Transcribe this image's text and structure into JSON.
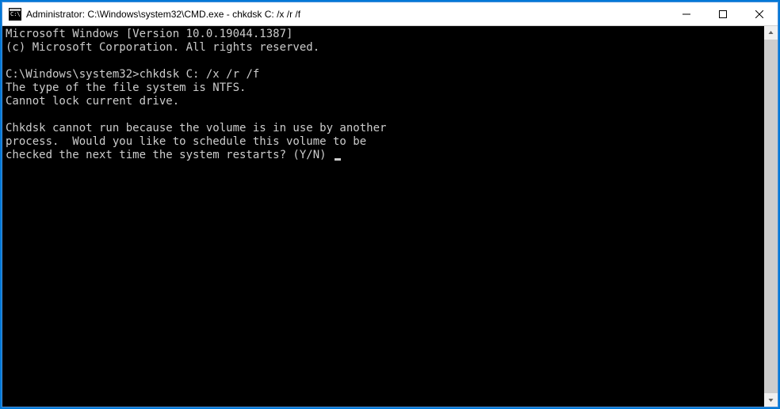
{
  "window": {
    "title": "Administrator: C:\\Windows\\system32\\CMD.exe - chkdsk  C: /x /r /f"
  },
  "terminal": {
    "line1": "Microsoft Windows [Version 10.0.19044.1387]",
    "line2": "(c) Microsoft Corporation. All rights reserved.",
    "line3": "",
    "prompt": "C:\\Windows\\system32>",
    "command": "chkdsk C: /x /r /f",
    "line5": "The type of the file system is NTFS.",
    "line6": "Cannot lock current drive.",
    "line7": "",
    "line8": "Chkdsk cannot run because the volume is in use by another",
    "line9": "process.  Would you like to schedule this volume to be",
    "line10": "checked the next time the system restarts? (Y/N) "
  }
}
